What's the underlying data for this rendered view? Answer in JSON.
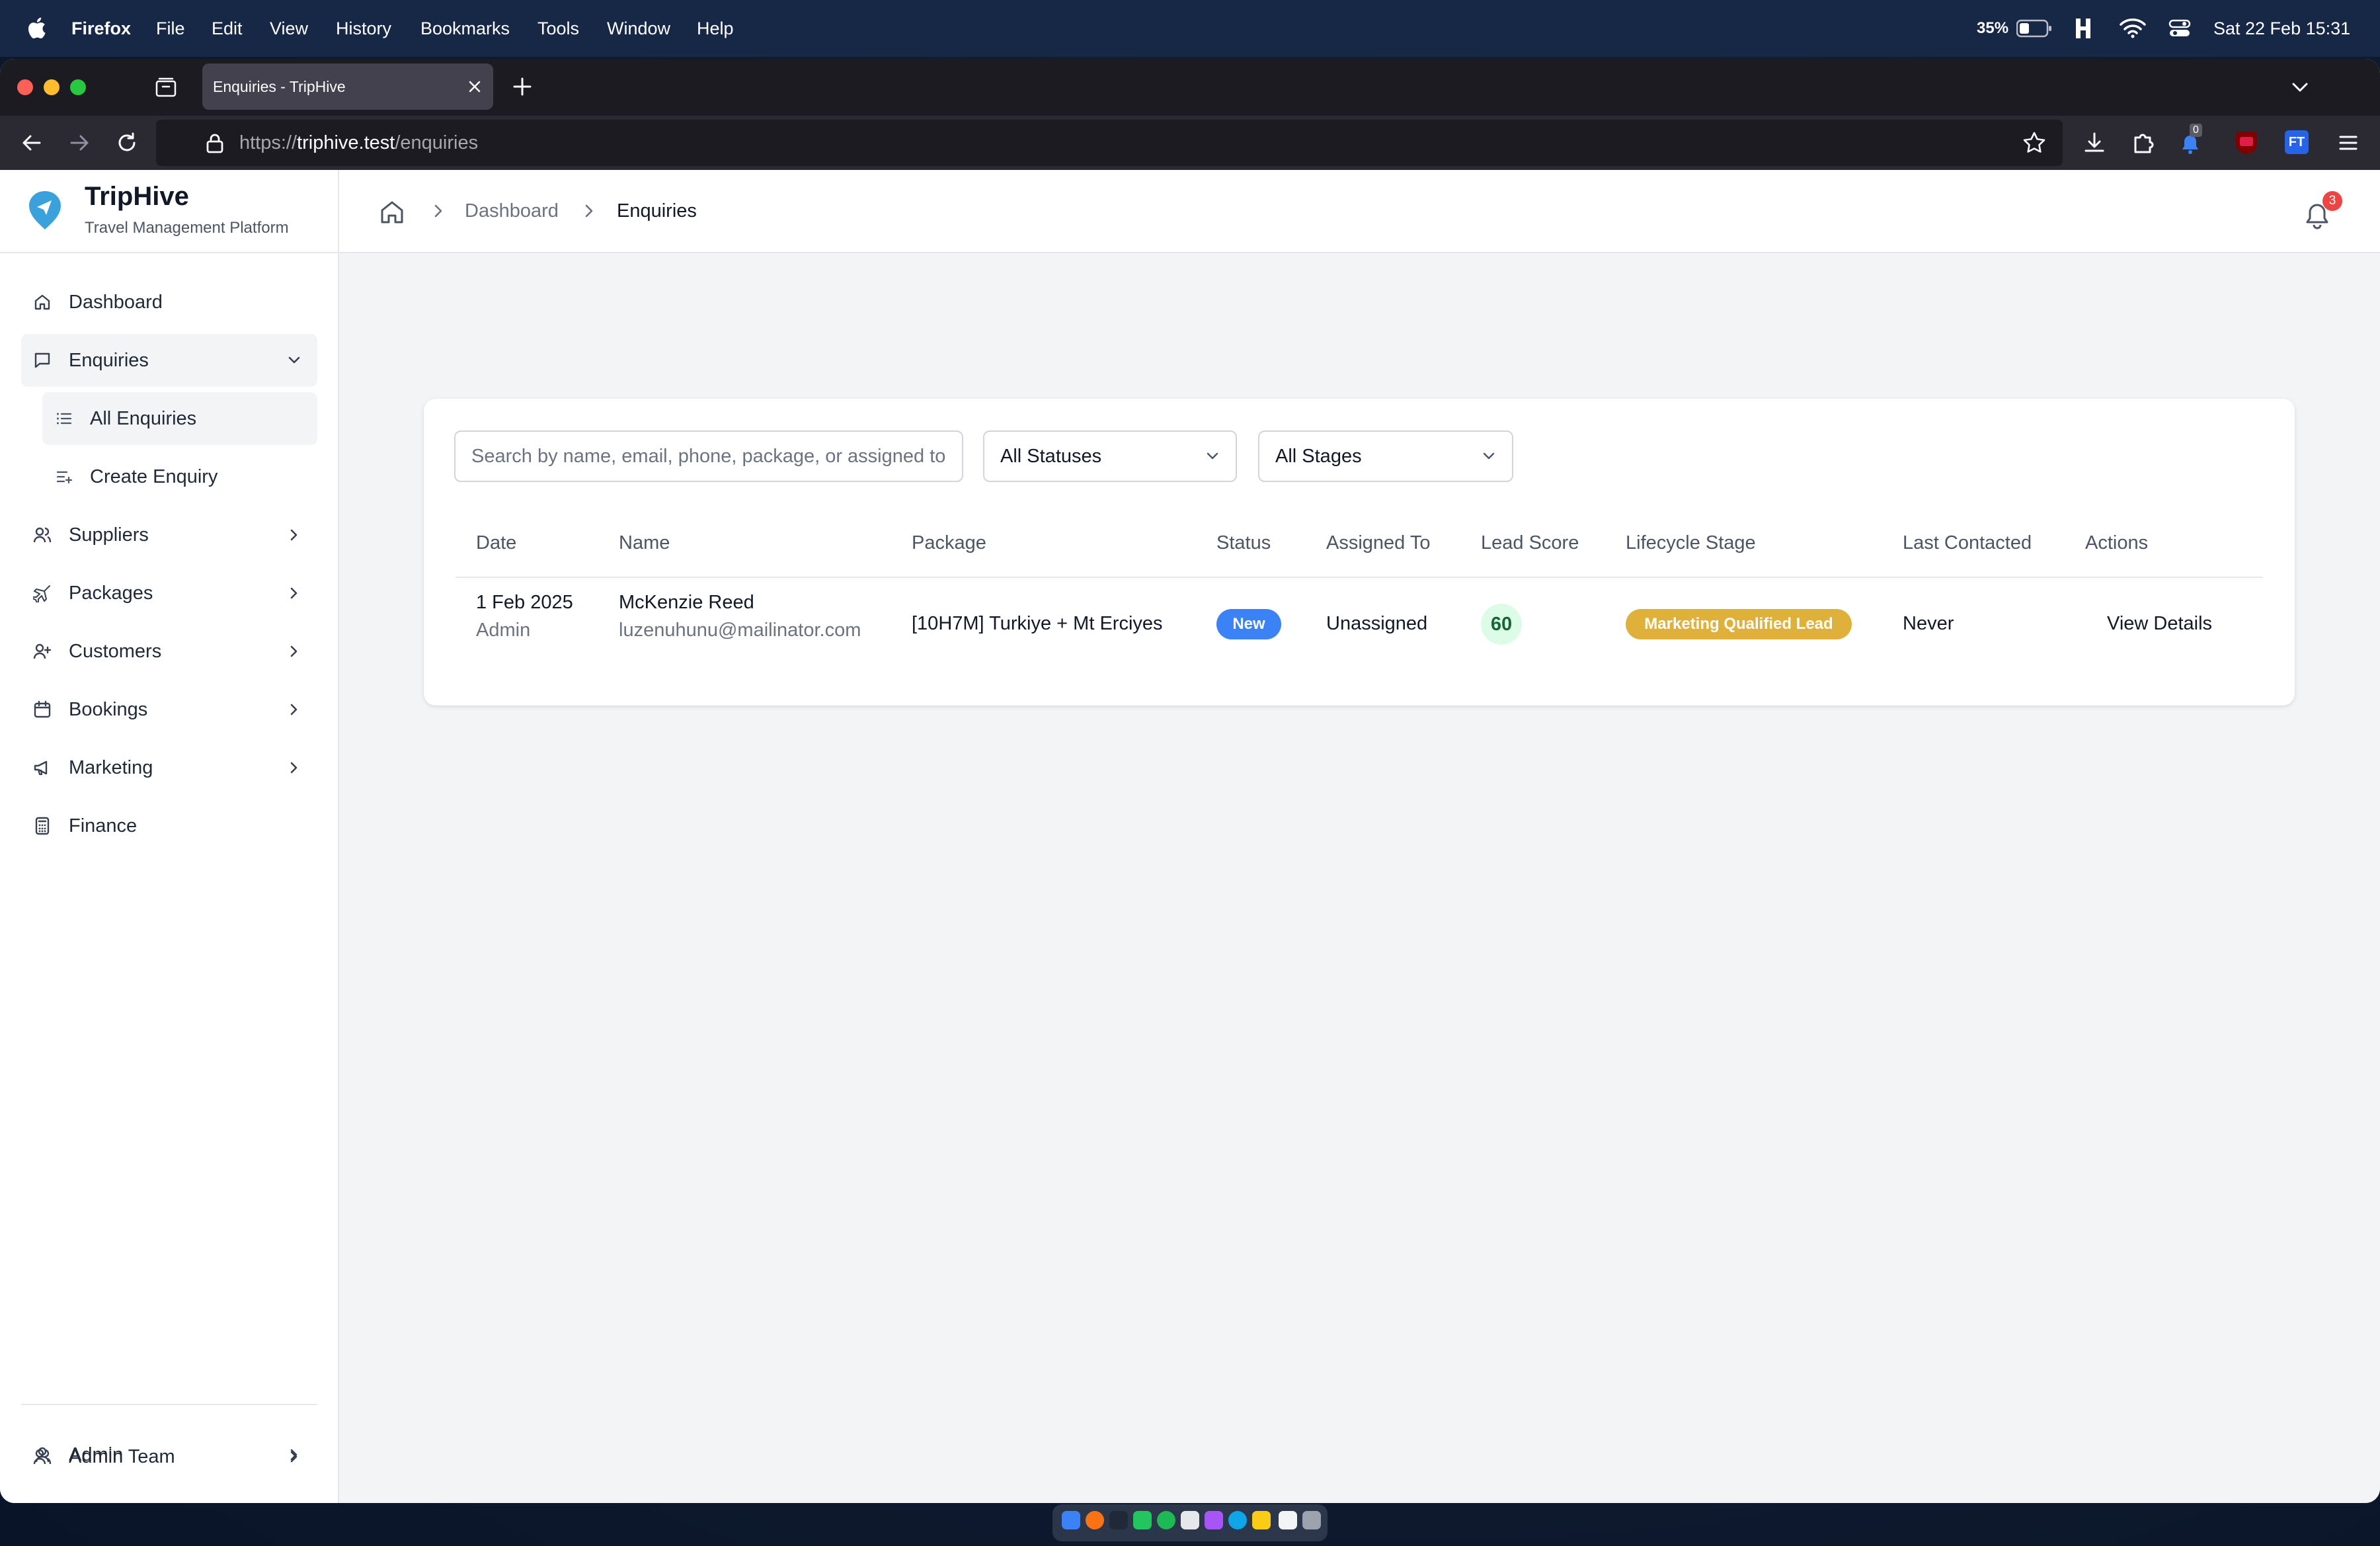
{
  "menubar": {
    "app_name": "Firefox",
    "menus": [
      "File",
      "Edit",
      "View",
      "History",
      "Bookmarks",
      "Tools",
      "Window",
      "Help"
    ],
    "battery": "35%",
    "datetime": "Sat 22 Feb  15:31"
  },
  "browser": {
    "tab_title": "Enquiries - TripHive",
    "url_scheme": "https://",
    "url_host": "triphive.test",
    "url_path": "/enquiries",
    "extension_badge": "0",
    "profile_initials": "FT"
  },
  "brand": {
    "title": "TripHive",
    "subtitle": "Travel Management Platform"
  },
  "sidebar": {
    "items": [
      {
        "label": "Dashboard"
      },
      {
        "label": "Enquiries"
      },
      {
        "label": "Suppliers"
      },
      {
        "label": "Packages"
      },
      {
        "label": "Customers"
      },
      {
        "label": "Bookings"
      },
      {
        "label": "Marketing"
      },
      {
        "label": "Finance"
      }
    ],
    "enquiries_sub": [
      {
        "label": "All Enquiries"
      },
      {
        "label": "Create Enquiry"
      }
    ],
    "bottom": [
      {
        "label": "Admin Team"
      },
      {
        "label": "Admin"
      }
    ]
  },
  "header": {
    "breadcrumb": [
      "Dashboard",
      "Enquiries"
    ],
    "notification_count": "3"
  },
  "filters": {
    "search_placeholder": "Search by name, email, phone, package, or assigned to",
    "status_value": "All Statuses",
    "stage_value": "All Stages"
  },
  "table": {
    "columns": [
      "Date",
      "Name",
      "Package",
      "Status",
      "Assigned To",
      "Lead Score",
      "Lifecycle Stage",
      "Last Contacted",
      "Actions"
    ],
    "rows": [
      {
        "date": "1 Feb 2025",
        "created_by": "Admin",
        "name": "McKenzie Reed",
        "email": "luzenuhunu@mailinator.com",
        "package": "[10H7M] Turkiye + Mt Erciyes",
        "status": "New",
        "assigned_to": "Unassigned",
        "lead_score": "60",
        "lifecycle_stage": "Marketing Qualified Lead",
        "last_contacted": "Never",
        "action": "View Details"
      }
    ]
  },
  "colors": {
    "status_new": "#3b82f6",
    "stage_badge": "#e0b13a",
    "score_bg": "#dcfce7",
    "score_text": "#166534",
    "brand_icon": "#3aa1dc"
  }
}
